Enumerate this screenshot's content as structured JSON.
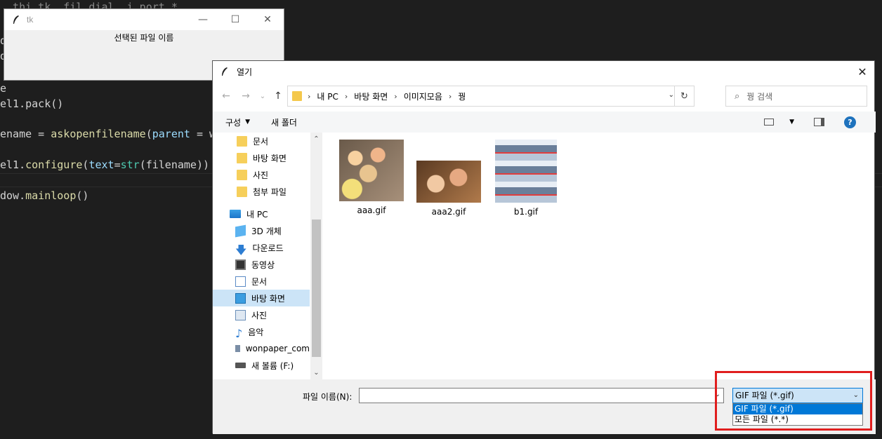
{
  "editor": {
    "line1": "  thi tk  fil dial  i port *",
    "line2": "el1.pack()",
    "line3_a": "ename = ",
    "line3_b": "askopenfilename",
    "line3_c": "(",
    "line3_d": "parent",
    "line3_e": " = wi",
    "line4_a": "el1.",
    "line4_b": "configure",
    "line4_c": "(",
    "line4_d": "text",
    "line4_e": "=",
    "line4_f": "str",
    "line4_g": "(filename))",
    "line5_a": "dow.",
    "line5_b": "mainloop",
    "line5_c": "()",
    "frag1": "d",
    "frag2": "d",
    "frag3": "e"
  },
  "tk_window": {
    "title": "tk",
    "label": "선택된 파일 이름",
    "min": "—",
    "max": "☐",
    "close": "✕"
  },
  "dialog": {
    "title": "열기",
    "close": "✕",
    "nav": {
      "back": "←",
      "forward": "→",
      "recent": "⌄",
      "up": "↑"
    },
    "breadcrumb": [
      "내 PC",
      "바탕 화면",
      "이미지모음",
      "꿩"
    ],
    "search_placeholder": "꿩 검색",
    "toolbar": {
      "organize": "구성",
      "new_folder": "새 폴더"
    },
    "sidebar": [
      {
        "label": "문서",
        "icon": "folder-icon"
      },
      {
        "label": "바탕 화면",
        "icon": "folder-icon"
      },
      {
        "label": "사진",
        "icon": "folder-icon"
      },
      {
        "label": "첨부 파일",
        "icon": "folder-icon"
      },
      {
        "label": "내 PC",
        "icon": "pc-icon"
      },
      {
        "label": "3D 개체",
        "icon": "3d-objects-icon"
      },
      {
        "label": "다운로드",
        "icon": "download-icon"
      },
      {
        "label": "동영상",
        "icon": "video-icon"
      },
      {
        "label": "문서",
        "icon": "document-icon"
      },
      {
        "label": "바탕 화면",
        "icon": "desktop-icon",
        "selected": true
      },
      {
        "label": "사진",
        "icon": "pictures-icon"
      },
      {
        "label": "음악",
        "icon": "music-icon"
      },
      {
        "label": "wonpaper_com",
        "icon": "network-icon"
      },
      {
        "label": "새 볼륨 (F:)",
        "icon": "drive-icon"
      }
    ],
    "files": [
      {
        "name": "aaa.gif"
      },
      {
        "name": "aaa2.gif"
      },
      {
        "name": "b1.gif"
      }
    ],
    "filename_label": "파일 이름(N):",
    "filename_value": "",
    "filetype": {
      "selected": "GIF 파일 (*.gif)",
      "options": [
        "GIF 파일 (*.gif)",
        "모든 파일 (*.*)"
      ]
    }
  },
  "colors": {
    "accent": "#0078d7",
    "highlight_box": "#e01e1e",
    "selection": "#cce4f7"
  }
}
